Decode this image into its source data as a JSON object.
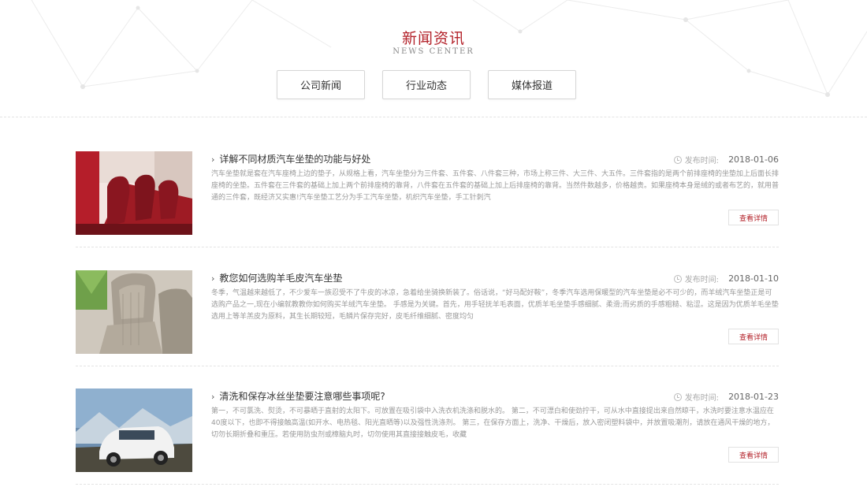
{
  "header": {
    "title": "新闻资讯",
    "subtitle": "NEWS CENTER"
  },
  "tabs": [
    {
      "label": "公司新闻"
    },
    {
      "label": "行业动态"
    },
    {
      "label": "媒体报道"
    }
  ],
  "news": [
    {
      "title": "详解不同材质汽车坐垫的功能与好处",
      "date_label": "发布时间:",
      "date": "2018-01-06",
      "excerpt": "汽车坐垫就是套在汽车座椅上边的垫子，从规格上看，汽车坐垫分为三件套、五件套、八件套三种，市场上称三件、大三件、大五件。三件套指的是两个前排座椅的坐垫加上后面长排座椅的坐垫。五件套在三件套的基础上加上两个前排座椅的靠背，八件套在五件套的基础上加上后排座椅的靠背。当然件数越多，价格越贵。如果座椅本身是绒的或者布艺的，就用普通的三件套，既经济又实惠!汽车坐垫工艺分为手工汽车坐垫，机织汽车坐垫，手工针刺汽",
      "more_label": "查看详情",
      "image": "red-leather-car-seats"
    },
    {
      "title": "教您如何选购羊毛皮汽车坐垫",
      "date_label": "发布时间:",
      "date": "2018-01-10",
      "excerpt": "冬季，气温越来越低了，不少爱车一族忍受不了牛皮的冰凉，急着给坐骑换新装了。俗话说，“好马配好鞍”，冬季汽车选用保暖型的汽车坐垫是必不可少的，而羊绒汽车坐垫正是可选购产品之一,现在小编就教教你如何购买羊绒汽车坐垫。      手感是为关键。首先，用手轻抚羊毛表面，优质羊毛坐垫手感细腻、柔滑;而劣质的手感粗糙、粘涩。这是因为优质羊毛坐垫选用上等羊羔皮为原料，其生长期较短，毛鳞片保存完好，皮毛纤维细腻、密度均匀",
      "more_label": "查看详情",
      "image": "grey-fabric-seat-cover"
    },
    {
      "title": "清洗和保存冰丝坐垫要注意哪些事项呢?",
      "date_label": "发布时间:",
      "date": "2018-01-23",
      "excerpt": "第一，不可氯洗、熨烫，不可暴晒于直射的太阳下。可放置在吸引袋中入洗衣机洗涤和脱水的。      第二，不可漂白和使劲拧干，可从水中直接提出来自然晾干，水洗时要注意水温应在40度以下，也即不得接触高温(如开水、电热毯、阳光直晒等)以及强性洗涤剂。      第三，在保存方面上，洗净、干燥后，放入密闭塑料袋中，并放置吸潮剂，请放在通风干燥的地方，切勿长期折叠和重压。若使用防虫剂或樟脑丸时，切勿使用其直接接触皮毛，收藏",
      "more_label": "查看详情",
      "image": "white-suv-off-road"
    }
  ]
}
